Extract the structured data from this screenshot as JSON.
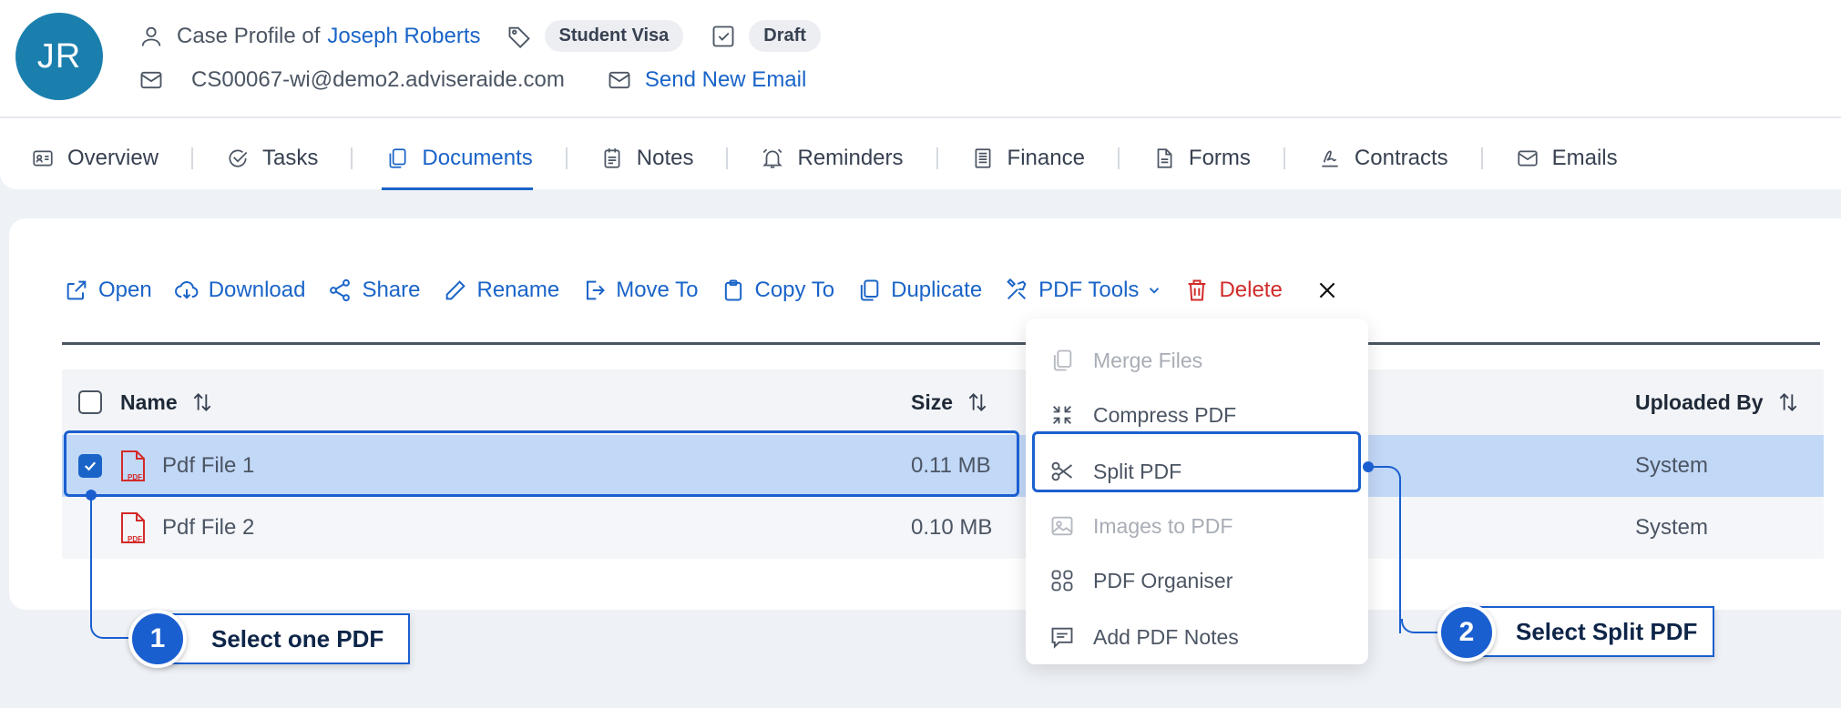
{
  "header": {
    "avatar_initials": "JR",
    "case_profile_prefix": "Case Profile of",
    "client_name": "Joseph Roberts",
    "visa_tag": "Student Visa",
    "status_tag": "Draft",
    "email": "CS00067-wi@demo2.adviseraide.com",
    "send_email_label": "Send New Email"
  },
  "tabs": [
    {
      "label": "Overview",
      "icon": "id-card-icon"
    },
    {
      "label": "Tasks",
      "icon": "check-circle-icon"
    },
    {
      "label": "Documents",
      "icon": "documents-icon",
      "active": true
    },
    {
      "label": "Notes",
      "icon": "notepad-icon"
    },
    {
      "label": "Reminders",
      "icon": "bell-icon"
    },
    {
      "label": "Finance",
      "icon": "ledger-icon"
    },
    {
      "label": "Forms",
      "icon": "form-icon"
    },
    {
      "label": "Contracts",
      "icon": "signature-icon"
    },
    {
      "label": "Emails",
      "icon": "mail-icon"
    }
  ],
  "toolbar": {
    "open": "Open",
    "download": "Download",
    "share": "Share",
    "rename": "Rename",
    "move_to": "Move To",
    "copy_to": "Copy To",
    "duplicate": "Duplicate",
    "pdf_tools": "PDF Tools",
    "delete": "Delete"
  },
  "table": {
    "columns": {
      "name": "Name",
      "size": "Size",
      "uploaded_by": "Uploaded By"
    },
    "rows": [
      {
        "name": "Pdf File 1",
        "size": "0.11 MB",
        "uploaded_by": "System",
        "selected": true
      },
      {
        "name": "Pdf File 2",
        "size": "0.10 MB",
        "uploaded_by": "System",
        "selected": false
      }
    ]
  },
  "pdf_menu": {
    "items": [
      {
        "label": "Merge Files",
        "disabled": true
      },
      {
        "label": "Compress PDF",
        "disabled": false
      },
      {
        "label": "Split PDF",
        "disabled": false,
        "highlighted": true
      },
      {
        "label": "Images to PDF",
        "disabled": true
      },
      {
        "label": "PDF Organiser",
        "disabled": false
      },
      {
        "label": "Add PDF Notes",
        "disabled": false
      }
    ]
  },
  "callouts": [
    {
      "number": "1",
      "text": "Select one PDF"
    },
    {
      "number": "2",
      "text": "Select Split PDF"
    }
  ],
  "colors": {
    "accent": "#1a64c8",
    "danger": "#d12b2b",
    "avatar": "#1b7fae",
    "selected_row": "#c2d8f7"
  }
}
